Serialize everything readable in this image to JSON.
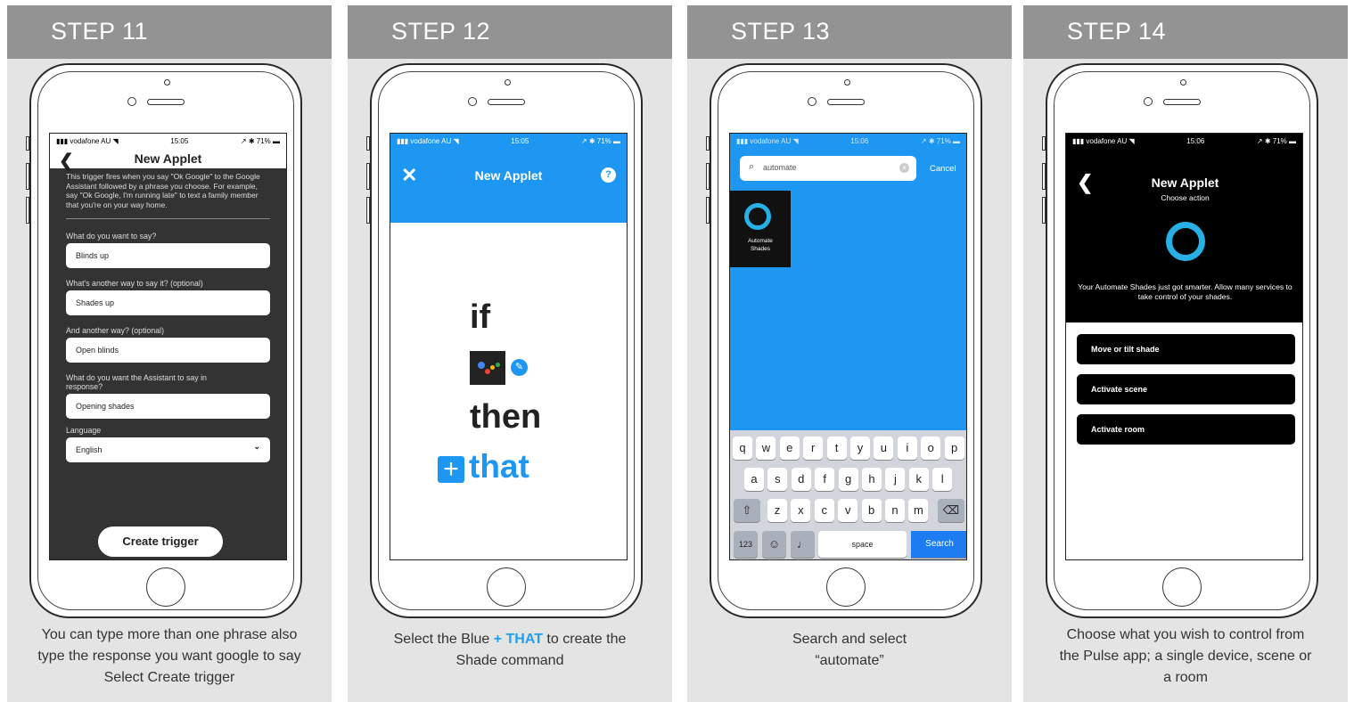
{
  "steps": [
    {
      "header": "STEP 11",
      "caption": "You can type more than one phrase also type the response you want google to say Select Create trigger",
      "screen": {
        "status_left": "▮▮▮ vodafone AU ◥",
        "status_time": "15:05",
        "status_right": "↗ ✱ 71% ▬",
        "back": "❮",
        "title": "New Applet",
        "description": "This trigger fires when you say \"Ok Google\" to the Google Assistant followed by a phrase you choose. For example, say \"Ok Google, I'm running late\" to text a family member that you're on your way home.",
        "fields": [
          {
            "label": "What do you want to say?",
            "value": "Blinds up"
          },
          {
            "label": "What's another way to say it? (optional)",
            "value": "Shades up"
          },
          {
            "label": "And another way? (optional)",
            "value": "Open blinds"
          },
          {
            "label": "What do you want the Assistant to say in response?",
            "value": "Opening shades"
          },
          {
            "label": "Language",
            "value": "English"
          }
        ],
        "select_arrow": "⌄",
        "create_label": "Create trigger"
      }
    },
    {
      "header": "STEP 12",
      "caption_prefix": "Select the Blue ",
      "caption_highlight": "+ THAT",
      "caption_suffix": " to create the Shade command",
      "screen": {
        "status_left": "▮▮▮ vodafone AU ◥",
        "status_time": "15:05",
        "status_right": "↗ ✱ 71% ▬",
        "close": "✕",
        "title": "New Applet",
        "help": "?",
        "if_text": "if",
        "pencil": "✎",
        "then_text": "then",
        "plus": "+",
        "that_text": "that"
      }
    },
    {
      "header": "STEP 13",
      "caption": "Search and select “automate”",
      "screen": {
        "status_left": "▮▮▮ vodafone AU ◥",
        "status_time": "15:06",
        "status_right": "↗ ✱ 71% ▬",
        "search_icon": "⌕",
        "search_value": "automate",
        "clear_icon": "×",
        "cancel": "Cancel",
        "tile_label": "Automate Shades",
        "keys_row1": [
          "q",
          "w",
          "e",
          "r",
          "t",
          "y",
          "u",
          "i",
          "o",
          "p"
        ],
        "keys_row2": [
          "a",
          "s",
          "d",
          "f",
          "g",
          "h",
          "j",
          "k",
          "l"
        ],
        "keys_row3": [
          "z",
          "x",
          "c",
          "v",
          "b",
          "n",
          "m"
        ],
        "shift": "⇧",
        "backspace": "⌫",
        "numbers": "123",
        "emoji": "☺",
        "mic": "♩",
        "space": "space",
        "search_key": "Search"
      }
    },
    {
      "header": "STEP 14",
      "caption": "Choose what you wish to control from the Pulse app; a single device, scene or a room",
      "screen": {
        "status_left": "▮▮▮ vodafone AU ◥",
        "status_time": "15:06",
        "status_right": "↗ ✱ 71% ▬",
        "back": "❮",
        "title": "New Applet",
        "subtitle": "Choose action",
        "message": "Your Automate Shades just got smarter. Allow many services to take control of your shades.",
        "options": [
          "Move or tilt shade",
          "Activate scene",
          "Activate room"
        ]
      }
    }
  ]
}
